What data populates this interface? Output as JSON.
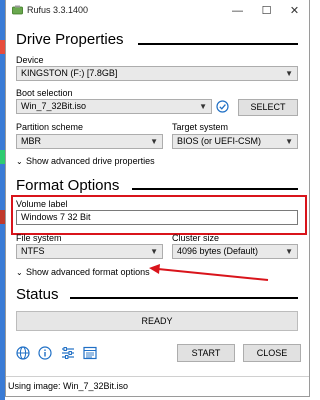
{
  "window": {
    "title": "Rufus 3.3.1400",
    "minimize_glyph": "—",
    "maximize_glyph": "☐",
    "close_glyph": "✕"
  },
  "drive_properties": {
    "heading": "Drive Properties",
    "device_label": "Device",
    "device_value": "KINGSTON (F:) [7.8GB]",
    "boot_label": "Boot selection",
    "boot_value": "Win_7_32Bit.iso",
    "select_button": "SELECT",
    "partition_label": "Partition scheme",
    "partition_value": "MBR",
    "target_label": "Target system",
    "target_value": "BIOS (or UEFI-CSM)",
    "advanced_toggle": "Show advanced drive properties"
  },
  "format_options": {
    "heading": "Format Options",
    "volume_label": "Volume label",
    "volume_value": "Windows 7 32 Bit",
    "filesystem_label": "File system",
    "filesystem_value": "NTFS",
    "cluster_label": "Cluster size",
    "cluster_value": "4096 bytes (Default)",
    "advanced_toggle": "Show advanced format options"
  },
  "status": {
    "heading": "Status",
    "state": "READY"
  },
  "actions": {
    "start": "START",
    "close": "CLOSE"
  },
  "footer": {
    "text": "Using image: Win_7_32Bit.iso"
  },
  "icons": [
    "rufus-app-icon",
    "globe-icon",
    "info-icon",
    "settings-sliders-icon",
    "log-icon",
    "check-hash-icon",
    "chevron-down-icon"
  ],
  "colors": {
    "annotation_red": "#d9141b",
    "icon_blue": "#1f6fc5"
  }
}
